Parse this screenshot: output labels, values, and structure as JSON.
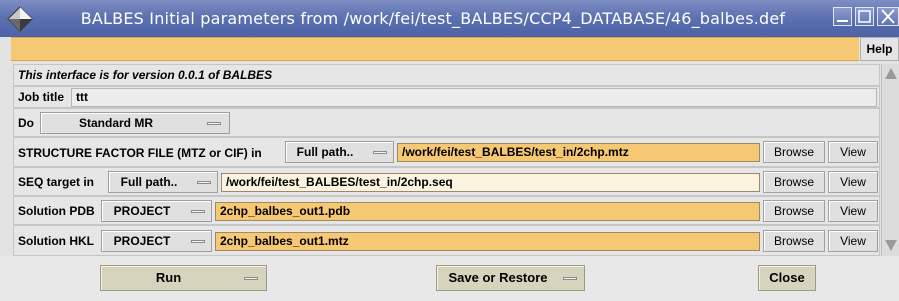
{
  "window": {
    "title": "BALBES  Initial parameters from /work/fei/test_BALBES/CCP4_DATABASE/46_balbes.def",
    "help_label": "Help"
  },
  "form": {
    "version_note": "This interface is for version 0.0.1 of BALBES",
    "job_title_label": "Job title",
    "job_title_value": "ttt",
    "do_label": "Do",
    "do_value": "Standard MR",
    "sf_label": "STRUCTURE FACTOR FILE (MTZ or CIF) in",
    "sf_mode": "Full path..",
    "sf_path": "/work/fei/test_BALBES/test_in/2chp.mtz",
    "seq_label": "SEQ target in",
    "seq_mode": "Full path..",
    "seq_path": "/work/fei/test_BALBES/test_in/2chp.seq",
    "pdb_label": "Solution PDB",
    "pdb_mode": "PROJECT",
    "pdb_file": "2chp_balbes_out1.pdb",
    "hkl_label": "Solution HKL",
    "hkl_mode": "PROJECT",
    "hkl_file": "2chp_balbes_out1.mtz",
    "browse_label": "Browse",
    "view_label": "View"
  },
  "actions": {
    "run_label": "Run",
    "save_restore_label": "Save or Restore",
    "close_label": "Close"
  },
  "colors": {
    "titlebar": "#5d72b1",
    "accent_orange": "#f7c873",
    "panel": "#e6e6e6"
  },
  "icons": [
    "app-diamond-icon",
    "minimize-icon",
    "maximize-icon",
    "close-icon",
    "dropdown-indicator-icon",
    "scroll-up-icon",
    "scroll-down-icon"
  ]
}
